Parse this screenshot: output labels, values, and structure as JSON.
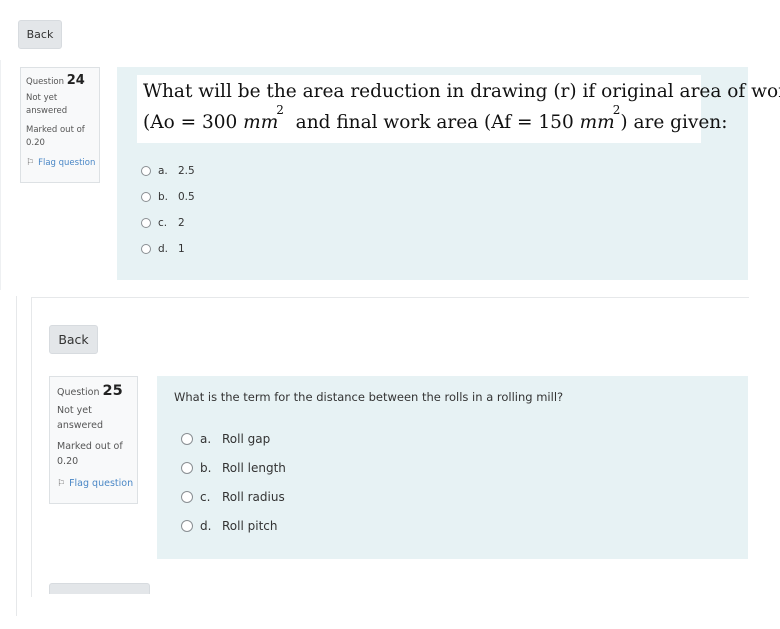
{
  "q24": {
    "back_label": "Back",
    "question_prefix": "Question",
    "number": "24",
    "state": [
      "Not yet",
      "answered"
    ],
    "marks": [
      "Marked out of",
      "0.20"
    ],
    "flag_label": "Flag question",
    "text_line1": "What will be the area reduction in drawing (r) if original area of work",
    "text_line2": {
      "a": "(Ao = 300 ",
      "unit": "mm",
      "sup": "2",
      "b": "  and final work area (Af = 150 ",
      "c": ") are given:"
    },
    "options": [
      {
        "letter": "a.",
        "text": "2.5"
      },
      {
        "letter": "b.",
        "text": "0.5"
      },
      {
        "letter": "c.",
        "text": "2"
      },
      {
        "letter": "d.",
        "text": "1"
      }
    ]
  },
  "q25": {
    "back_label": "Back",
    "question_prefix": "Question",
    "number": "25",
    "state": [
      "Not yet",
      "answered"
    ],
    "marks": [
      "Marked out of",
      "0.20"
    ],
    "flag_label": "Flag question",
    "text": "What is the term for the distance between the rolls in a rolling mill?",
    "options": [
      {
        "letter": "a.",
        "text": "Roll gap"
      },
      {
        "letter": "b.",
        "text": "Roll length"
      },
      {
        "letter": "c.",
        "text": "Roll radius"
      },
      {
        "letter": "d.",
        "text": "Roll pitch"
      }
    ]
  },
  "icons": {
    "flag": "flag-icon",
    "radio": "radio-button"
  }
}
